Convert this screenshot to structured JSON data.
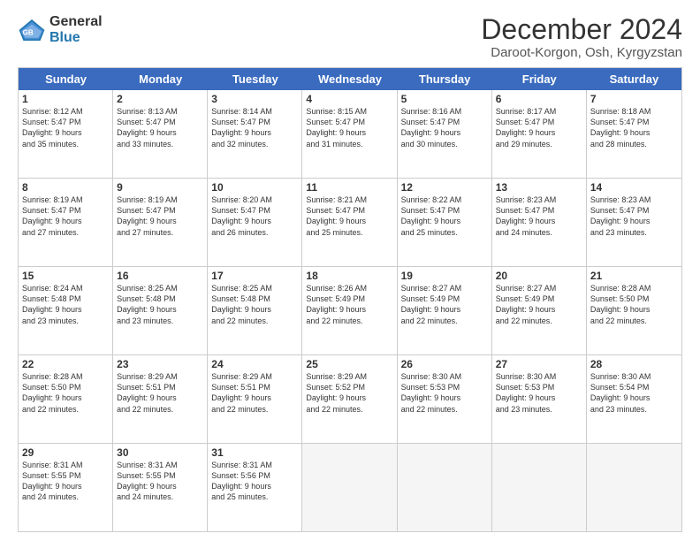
{
  "logo": {
    "general": "General",
    "blue": "Blue"
  },
  "title": "December 2024",
  "subtitle": "Daroot-Korgon, Osh, Kyrgyzstan",
  "days": [
    "Sunday",
    "Monday",
    "Tuesday",
    "Wednesday",
    "Thursday",
    "Friday",
    "Saturday"
  ],
  "weeks": [
    [
      {
        "day": "1",
        "sunrise": "8:12 AM",
        "sunset": "5:47 PM",
        "hours": "9",
        "minutes": "35"
      },
      {
        "day": "2",
        "sunrise": "8:13 AM",
        "sunset": "5:47 PM",
        "hours": "9",
        "minutes": "33"
      },
      {
        "day": "3",
        "sunrise": "8:14 AM",
        "sunset": "5:47 PM",
        "hours": "9",
        "minutes": "32"
      },
      {
        "day": "4",
        "sunrise": "8:15 AM",
        "sunset": "5:47 PM",
        "hours": "9",
        "minutes": "31"
      },
      {
        "day": "5",
        "sunrise": "8:16 AM",
        "sunset": "5:47 PM",
        "hours": "9",
        "minutes": "30"
      },
      {
        "day": "6",
        "sunrise": "8:17 AM",
        "sunset": "5:47 PM",
        "hours": "9",
        "minutes": "29"
      },
      {
        "day": "7",
        "sunrise": "8:18 AM",
        "sunset": "5:47 PM",
        "hours": "9",
        "minutes": "28"
      }
    ],
    [
      {
        "day": "8",
        "sunrise": "8:19 AM",
        "sunset": "5:47 PM",
        "hours": "9",
        "minutes": "27"
      },
      {
        "day": "9",
        "sunrise": "8:19 AM",
        "sunset": "5:47 PM",
        "hours": "9",
        "minutes": "27"
      },
      {
        "day": "10",
        "sunrise": "8:20 AM",
        "sunset": "5:47 PM",
        "hours": "9",
        "minutes": "26"
      },
      {
        "day": "11",
        "sunrise": "8:21 AM",
        "sunset": "5:47 PM",
        "hours": "9",
        "minutes": "25"
      },
      {
        "day": "12",
        "sunrise": "8:22 AM",
        "sunset": "5:47 PM",
        "hours": "9",
        "minutes": "25"
      },
      {
        "day": "13",
        "sunrise": "8:23 AM",
        "sunset": "5:47 PM",
        "hours": "9",
        "minutes": "24"
      },
      {
        "day": "14",
        "sunrise": "8:23 AM",
        "sunset": "5:47 PM",
        "hours": "9",
        "minutes": "23"
      }
    ],
    [
      {
        "day": "15",
        "sunrise": "8:24 AM",
        "sunset": "5:48 PM",
        "hours": "9",
        "minutes": "23"
      },
      {
        "day": "16",
        "sunrise": "8:25 AM",
        "sunset": "5:48 PM",
        "hours": "9",
        "minutes": "23"
      },
      {
        "day": "17",
        "sunrise": "8:25 AM",
        "sunset": "5:48 PM",
        "hours": "9",
        "minutes": "22"
      },
      {
        "day": "18",
        "sunrise": "8:26 AM",
        "sunset": "5:49 PM",
        "hours": "9",
        "minutes": "22"
      },
      {
        "day": "19",
        "sunrise": "8:27 AM",
        "sunset": "5:49 PM",
        "hours": "9",
        "minutes": "22"
      },
      {
        "day": "20",
        "sunrise": "8:27 AM",
        "sunset": "5:49 PM",
        "hours": "9",
        "minutes": "22"
      },
      {
        "day": "21",
        "sunrise": "8:28 AM",
        "sunset": "5:50 PM",
        "hours": "9",
        "minutes": "22"
      }
    ],
    [
      {
        "day": "22",
        "sunrise": "8:28 AM",
        "sunset": "5:50 PM",
        "hours": "9",
        "minutes": "22"
      },
      {
        "day": "23",
        "sunrise": "8:29 AM",
        "sunset": "5:51 PM",
        "hours": "9",
        "minutes": "22"
      },
      {
        "day": "24",
        "sunrise": "8:29 AM",
        "sunset": "5:51 PM",
        "hours": "9",
        "minutes": "22"
      },
      {
        "day": "25",
        "sunrise": "8:29 AM",
        "sunset": "5:52 PM",
        "hours": "9",
        "minutes": "22"
      },
      {
        "day": "26",
        "sunrise": "8:30 AM",
        "sunset": "5:53 PM",
        "hours": "9",
        "minutes": "22"
      },
      {
        "day": "27",
        "sunrise": "8:30 AM",
        "sunset": "5:53 PM",
        "hours": "9",
        "minutes": "23"
      },
      {
        "day": "28",
        "sunrise": "8:30 AM",
        "sunset": "5:54 PM",
        "hours": "9",
        "minutes": "23"
      }
    ],
    [
      {
        "day": "29",
        "sunrise": "8:31 AM",
        "sunset": "5:55 PM",
        "hours": "9",
        "minutes": "24"
      },
      {
        "day": "30",
        "sunrise": "8:31 AM",
        "sunset": "5:55 PM",
        "hours": "9",
        "minutes": "24"
      },
      {
        "day": "31",
        "sunrise": "8:31 AM",
        "sunset": "5:56 PM",
        "hours": "9",
        "minutes": "25"
      },
      null,
      null,
      null,
      null
    ]
  ],
  "labels": {
    "sunrise": "Sunrise:",
    "sunset": "Sunset:",
    "daylight": "Daylight: ",
    "hours_suffix": " hours",
    "and": "and ",
    "minutes_suffix": " minutes."
  }
}
